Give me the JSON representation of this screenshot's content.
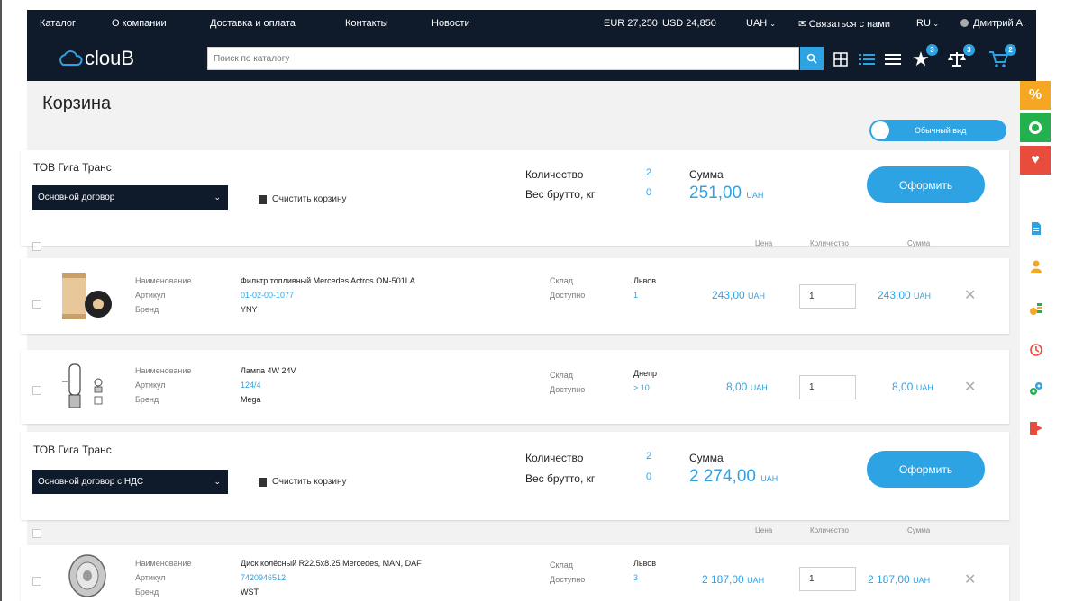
{
  "nav": {
    "catalog": "Каталог",
    "about": "О компании",
    "delivery": "Доставка и оплата",
    "contacts": "Контакты",
    "news": "Новости",
    "eur": "EUR 27,250",
    "usd": "USD 24,850",
    "currency": "UAH",
    "contact_us": "Связаться с нами",
    "lang": "RU",
    "user": "Дмитрий А."
  },
  "logo": {
    "text": "clouB"
  },
  "search": {
    "placeholder": "Поиск по каталогу"
  },
  "toolbar": {
    "favorites_count": "3",
    "compare_count": "3",
    "cart_count": "2"
  },
  "page": {
    "title": "Корзина",
    "view_toggle": "Обычный вид"
  },
  "labels": {
    "quantity": "Количество",
    "weight": "Вес брутто, кг",
    "sum": "Сумма",
    "checkout": "Оформить",
    "clear_cart": "Очистить корзину",
    "col_price": "Цена",
    "col_qty": "Количество",
    "col_sum": "Сумма",
    "name": "Наименование",
    "article": "Артикул",
    "brand": "Бренд",
    "warehouse": "Склад",
    "available": "Доступно",
    "currency": "UAH"
  },
  "groups": [
    {
      "company": "ТОВ Гига Транс",
      "contract": "Основной договор",
      "quantity": "2",
      "weight": "0",
      "sum": "251,00",
      "items": [
        {
          "name": "Фильтр топливный Mercedes Actros OM-501LA",
          "article": "01-02-00-1077",
          "brand": "YNY",
          "warehouse": "Львов",
          "available": "1",
          "price": "243,00",
          "qty": "1",
          "sum": "243,00",
          "image": "fuel-filter-image"
        },
        {
          "name": "Лампа 4W 24V",
          "article": "124/4",
          "brand": "Mega",
          "warehouse": "Днепр",
          "available": "> 10",
          "price": "8,00",
          "qty": "1",
          "sum": "8,00",
          "image": "lamp-image"
        }
      ]
    },
    {
      "company": "ТОВ Гига Транс",
      "contract": "Основной договор с НДС",
      "quantity": "2",
      "weight": "0",
      "sum": "2 274,00",
      "items": [
        {
          "name": "Диск колёсный R22.5x8.25 Mercedes, MAN, DAF",
          "article": "7420946512",
          "brand": "WST",
          "warehouse": "Львов",
          "available": "3",
          "price": "2 187,00",
          "qty": "1",
          "sum": "2 187,00",
          "image": "wheel-disk-image"
        }
      ]
    }
  ],
  "rail": {
    "tabs": [
      {
        "icon": "percent-icon",
        "color": "#f5a623",
        "glyph": "%"
      },
      {
        "icon": "new-badge-icon",
        "color": "#22b14c",
        "glyph": ""
      },
      {
        "icon": "heart-icon",
        "color": "#e74c3c",
        "glyph": "♥"
      }
    ],
    "icons": [
      "document-icon",
      "user-icon",
      "coins-icon",
      "history-icon",
      "settings-icon",
      "logout-icon"
    ]
  },
  "colors": {
    "navy": "#0f1a2b",
    "accent": "#2ea3e4"
  }
}
